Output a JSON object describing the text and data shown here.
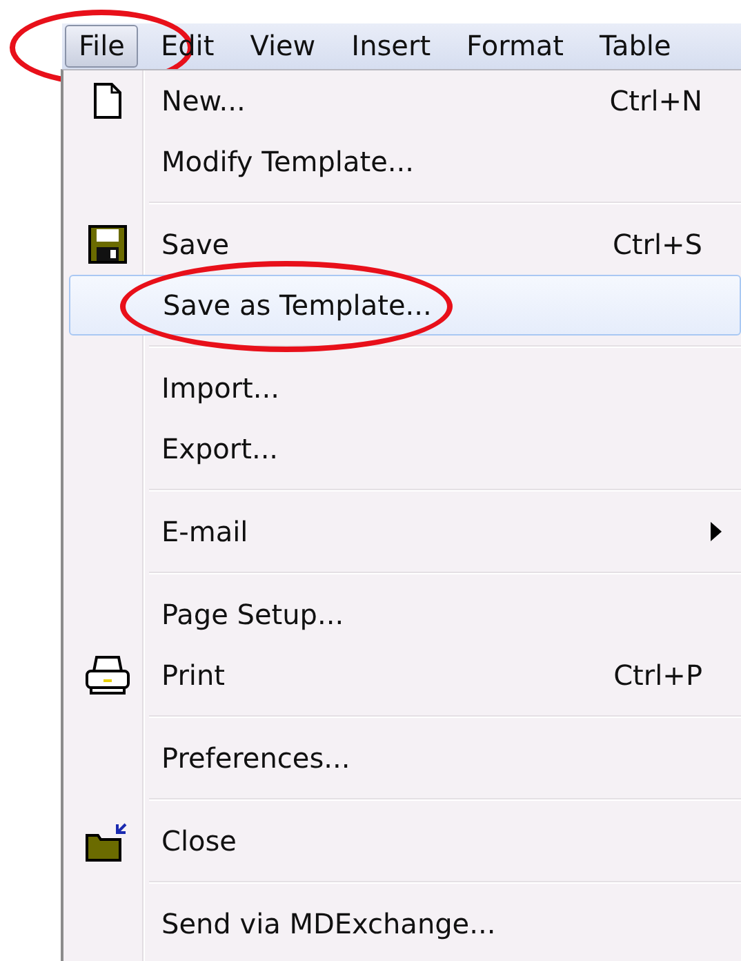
{
  "menubar": [
    {
      "label": "File",
      "selected": true,
      "circled": true
    },
    {
      "label": "Edit",
      "selected": false,
      "circled": false
    },
    {
      "label": "View",
      "selected": false,
      "circled": false
    },
    {
      "label": "Insert",
      "selected": false,
      "circled": false
    },
    {
      "label": "Format",
      "selected": false,
      "circled": false
    },
    {
      "label": "Table",
      "selected": false,
      "circled": false
    }
  ],
  "menu": [
    {
      "kind": "item",
      "label": "New...",
      "shortcut": "Ctrl+N",
      "selected": false,
      "circled": false
    },
    {
      "kind": "item",
      "label": "Modify Template...",
      "selected": false,
      "circled": false
    },
    {
      "kind": "separator"
    },
    {
      "kind": "item",
      "label": "Save",
      "shortcut": "Ctrl+S",
      "selected": false,
      "circled": false
    },
    {
      "kind": "item",
      "label": "Save as Template...",
      "selected": true,
      "circled": true
    },
    {
      "kind": "separator"
    },
    {
      "kind": "item",
      "label": "Import...",
      "selected": false,
      "circled": false
    },
    {
      "kind": "item",
      "label": "Export...",
      "selected": false,
      "circled": false
    },
    {
      "kind": "separator"
    },
    {
      "kind": "item",
      "label": "E-mail",
      "selected": false,
      "circled": false,
      "submenu": true
    },
    {
      "kind": "separator"
    },
    {
      "kind": "item",
      "label": "Page Setup...",
      "selected": false,
      "circled": false
    },
    {
      "kind": "item",
      "label": "Print",
      "shortcut": "Ctrl+P",
      "selected": false,
      "circled": false
    },
    {
      "kind": "separator"
    },
    {
      "kind": "item",
      "label": "Preferences...",
      "selected": false,
      "circled": false
    },
    {
      "kind": "separator"
    },
    {
      "kind": "item",
      "label": "Close",
      "selected": false,
      "circled": false
    },
    {
      "kind": "separator"
    },
    {
      "kind": "item",
      "label": "Send via MDExchange...",
      "selected": false,
      "circled": false
    }
  ]
}
